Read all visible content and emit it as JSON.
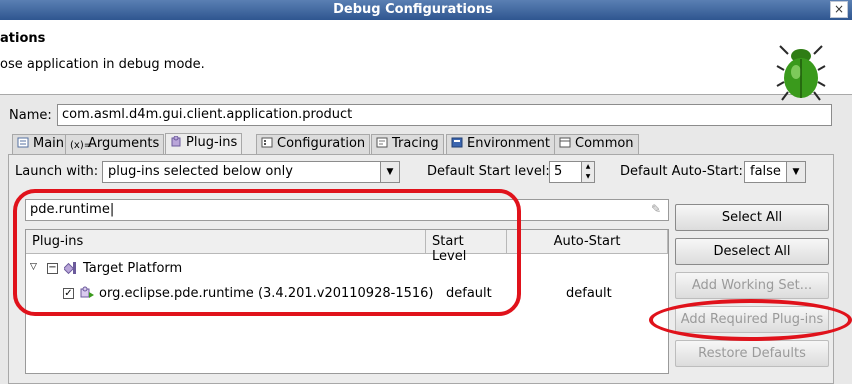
{
  "window": {
    "title": "Debug Configurations",
    "close_glyph": "×"
  },
  "header": {
    "title": "ations",
    "description": "ose application in debug mode."
  },
  "name": {
    "label": "Name:",
    "value": "com.asml.d4m.gui.client.application.product"
  },
  "tabs": [
    {
      "label": "Main",
      "icon": "main-tab-icon",
      "active": false
    },
    {
      "label": "Arguments",
      "icon": "arguments-icon",
      "active": false
    },
    {
      "label": "Plug-ins",
      "icon": "plugins-icon",
      "active": true
    },
    {
      "label": "Configuration",
      "icon": "configuration-icon",
      "active": false
    },
    {
      "label": "Tracing",
      "icon": "tracing-icon",
      "active": false
    },
    {
      "label": "Environment",
      "icon": "environment-icon",
      "active": false
    },
    {
      "label": "Common",
      "icon": "common-icon",
      "active": false
    }
  ],
  "launch": {
    "label": "Launch with:",
    "value": "plug-ins selected below only"
  },
  "start_level": {
    "label": "Default Start level:",
    "value": "5"
  },
  "auto_start": {
    "label": "Default Auto-Start:",
    "value": "false"
  },
  "filter": {
    "value": "pde.runtime"
  },
  "table": {
    "headers": [
      "Plug-ins",
      "Start Level",
      "Auto-Start"
    ],
    "group": {
      "label": "Target Platform",
      "expanded": true
    },
    "rows": [
      {
        "name": "org.eclipse.pde.runtime (3.4.201.v20110928-1516)",
        "start_level": "default",
        "auto_start": "default",
        "checked": true
      }
    ]
  },
  "buttons": {
    "select_all": "Select All",
    "deselect_all": "Deselect All",
    "add_working_set": "Add Working Set...",
    "add_required": "Add Required Plug-ins",
    "restore_defaults": "Restore Defaults"
  },
  "colors": {
    "annotation": "#e0121b",
    "title_bar": "#3d649c",
    "bug_green": "#3a9a1c"
  }
}
